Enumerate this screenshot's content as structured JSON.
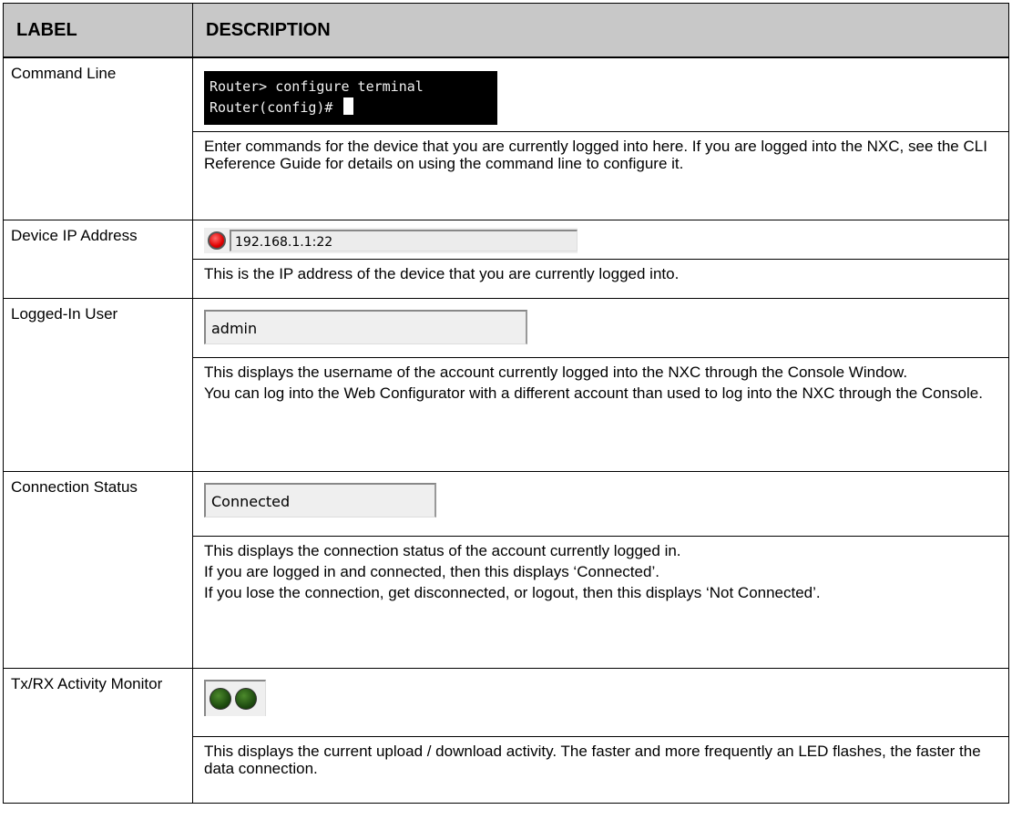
{
  "headers": {
    "label": "LABEL",
    "description": "DESCRIPTION"
  },
  "rows": [
    {
      "label": "Command Line",
      "screenshot": {
        "line1": "Router> configure terminal",
        "line2": "Router(config)# "
      },
      "desc": [
        "Enter commands for the device that you are currently logged into here. If you are logged into the NXC, see the CLI Reference Guide for details on using the command line to configure it."
      ]
    },
    {
      "label": "Device IP Address",
      "screenshot": {
        "value": "192.168.1.1:22",
        "led_color": "#e00000"
      },
      "desc": [
        "This is the IP address of the device that you are currently logged into."
      ]
    },
    {
      "label": "Logged-In User",
      "screenshot": {
        "value": "admin"
      },
      "desc": [
        "This displays the username of the account currently logged into the NXC through the Console Window.",
        "You can log into the Web Configurator with a different account than used to log into the NXC through the Console."
      ]
    },
    {
      "label": "Connection Status",
      "screenshot": {
        "value": "Connected"
      },
      "desc": [
        "This displays the connection status of the account currently logged in.",
        "If you are logged in and connected, then this displays ‘Connected’.",
        "If you lose the connection, get disconnected, or logout, then this displays ‘Not Connected’."
      ]
    },
    {
      "label": "Tx/RX Activity Monitor",
      "screenshot": {
        "led_color": "#1f4d10"
      },
      "desc": [
        "This displays the current upload / download activity. The faster and more frequently an LED flashes, the faster the data connection."
      ]
    }
  ]
}
